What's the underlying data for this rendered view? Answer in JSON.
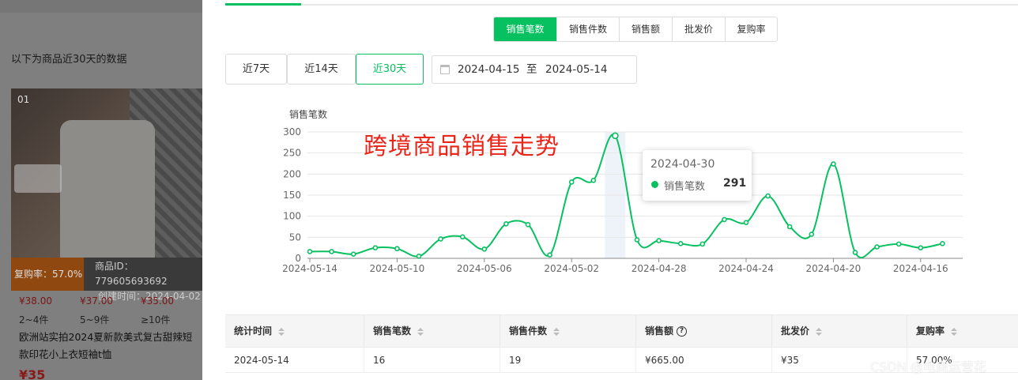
{
  "left": {
    "intro": "以下为商品近30天的数据",
    "rank": "01",
    "repurchase": "复购率：57.0%",
    "product_id": "商品ID：779605693692",
    "created": "创建时间：2024-04-02",
    "prices": [
      "¥38.00",
      "¥37.00",
      "¥35.00"
    ],
    "tiers": [
      "2~4件",
      "5~9件",
      "≥10件"
    ],
    "title": "欧洲站实拍2024夏新款美式复古甜辣短款印花小上衣短袖t恤",
    "price_big": "¥35"
  },
  "metric_tabs": [
    {
      "label": "销售笔数",
      "active": true
    },
    {
      "label": "销售件数",
      "active": false
    },
    {
      "label": "销售额",
      "active": false
    },
    {
      "label": "批发价",
      "active": false
    },
    {
      "label": "复购率",
      "active": false
    }
  ],
  "ranges": [
    {
      "label": "近7天",
      "active": false
    },
    {
      "label": "近14天",
      "active": false
    },
    {
      "label": "近30天",
      "active": true
    }
  ],
  "date_range": {
    "start": "2024-04-15",
    "separator": "至",
    "end": "2024-05-14"
  },
  "overlay_title": "跨境商品销售走势",
  "tooltip": {
    "date": "2024-04-30",
    "label": "销售笔数",
    "value": "291"
  },
  "chart_data": {
    "type": "line",
    "ylabel": "销售笔数",
    "ylim": [
      0,
      300
    ],
    "yticks": [
      0,
      50,
      100,
      150,
      200,
      250,
      300
    ],
    "grid": true,
    "color": "#07c160",
    "highlight": "2024-04-30",
    "x_tick_labels": [
      "2024-05-14",
      "2024-05-10",
      "2024-05-06",
      "2024-05-02",
      "2024-04-28",
      "2024-04-24",
      "2024-04-20",
      "2024-04-16"
    ],
    "x": [
      "2024-05-14",
      "2024-05-13",
      "2024-05-12",
      "2024-05-11",
      "2024-05-10",
      "2024-05-09",
      "2024-05-08",
      "2024-05-07",
      "2024-05-06",
      "2024-05-05",
      "2024-05-04",
      "2024-05-03",
      "2024-05-02",
      "2024-05-01",
      "2024-04-30",
      "2024-04-29",
      "2024-04-28",
      "2024-04-27",
      "2024-04-26",
      "2024-04-25",
      "2024-04-24",
      "2024-04-23",
      "2024-04-22",
      "2024-04-21",
      "2024-04-20",
      "2024-04-19",
      "2024-04-18",
      "2024-04-17",
      "2024-04-16",
      "2024-04-15"
    ],
    "values": [
      16,
      16,
      10,
      25,
      23,
      5,
      46,
      51,
      22,
      82,
      80,
      8,
      181,
      185,
      291,
      44,
      42,
      35,
      34,
      92,
      85,
      148,
      75,
      57,
      224,
      14,
      27,
      34,
      25,
      35
    ]
  },
  "table": {
    "headers": [
      {
        "label": "统计时间",
        "sort": true,
        "help": false
      },
      {
        "label": "销售笔数",
        "sort": true,
        "help": false
      },
      {
        "label": "销售件数",
        "sort": true,
        "help": false
      },
      {
        "label": "销售额",
        "sort": false,
        "help": true
      },
      {
        "label": "批发价",
        "sort": true,
        "help": false
      },
      {
        "label": "复购率",
        "sort": true,
        "help": false
      }
    ],
    "rows": [
      [
        "2024-05-14",
        "16",
        "19",
        "¥665.00",
        "¥35",
        "57.00%"
      ]
    ]
  },
  "watermark": "CSDN @电商运营花"
}
